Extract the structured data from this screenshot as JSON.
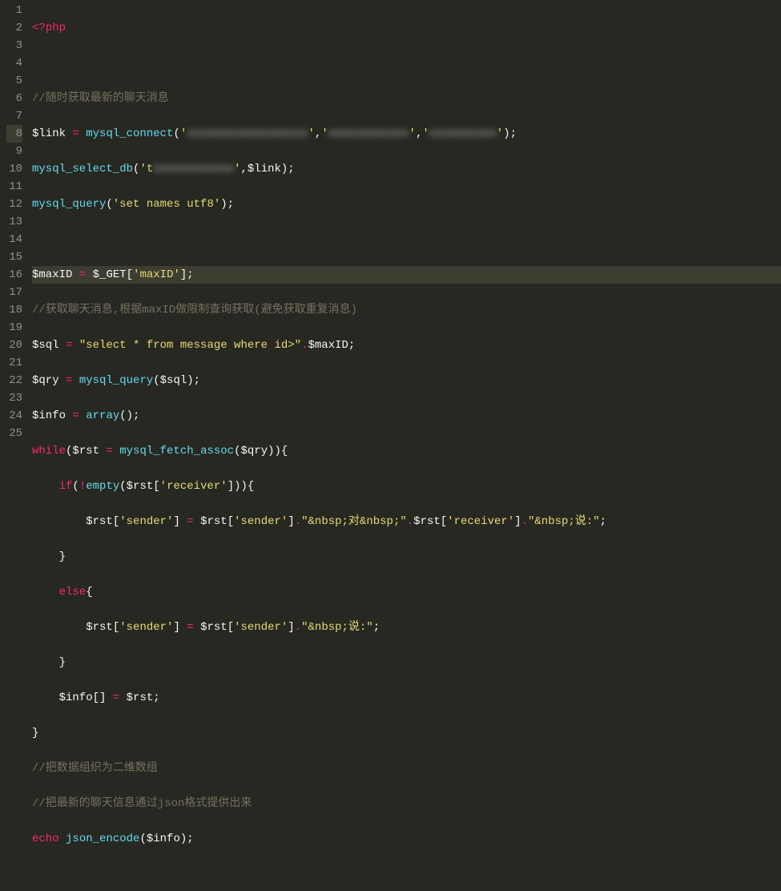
{
  "gutter": [
    "1",
    "2",
    "3",
    "4",
    "5",
    "6",
    "7",
    "8",
    "9",
    "10",
    "11",
    "12",
    "13",
    "14",
    "15",
    "16",
    "17",
    "18",
    "19",
    "20",
    "21",
    "22",
    "23",
    "24",
    "25"
  ],
  "highlighted_line": 8,
  "code": {
    "l1": {
      "php_open": "<?php"
    },
    "l3": {
      "comment": "//随时获取最新的聊天消息"
    },
    "l4": {
      "var": "$link",
      "assign": " = ",
      "fn": "mysql_connect",
      "lp": "(",
      "s1": "'",
      "blur1": "xxxxxxxxxxxxxxxxxx",
      "s1e": "'",
      "c1": ",",
      "s2": "'",
      "blur2": "xxxxxxxxxxxx",
      "s2e": "'",
      "c2": ",",
      "s3": "'",
      "blur3": "xxxxxxxxxx",
      "s3e": "'",
      "rp": ");"
    },
    "l5": {
      "fn": "mysql_select_db",
      "lp": "(",
      "s1": "'",
      "char": "t",
      "blur": "xxxxxxxxxxxx",
      "s1e": "'",
      "c": ",",
      "var": "$link",
      "rp": ");"
    },
    "l6": {
      "fn": "mysql_query",
      "lp": "(",
      "str": "'set names utf8'",
      "rp": ");"
    },
    "l8": {
      "var": "$maxID",
      "assign": " = ",
      "var2": "$_GET",
      "lb": "[",
      "str": "'maxID'",
      "rb": "];"
    },
    "l9": {
      "comment": "//获取聊天消息,根据maxID做限制查询获取(避免获取重复消息)"
    },
    "l10": {
      "var": "$sql",
      "assign": " = ",
      "str": "\"select * from message where id>\"",
      "dot": ".",
      "var2": "$maxID",
      "semi": ";"
    },
    "l11": {
      "var": "$qry",
      "assign": " = ",
      "fn": "mysql_query",
      "lp": "(",
      "arg": "$sql",
      "rp": ");"
    },
    "l12": {
      "var": "$info",
      "assign": " = ",
      "fn": "array",
      "lp": "(",
      "rp": ");"
    },
    "l13": {
      "kw": "while",
      "lp": "(",
      "var": "$rst",
      "assign": " = ",
      "fn": "mysql_fetch_assoc",
      "lp2": "(",
      "arg": "$qry",
      "rp2": ")",
      "rp": "){"
    },
    "l14": {
      "indent": "    ",
      "kw": "if",
      "lp": "(",
      "not": "!",
      "fn": "empty",
      "lp2": "(",
      "var": "$rst",
      "lb": "[",
      "str": "'receiver'",
      "rb": "]",
      "rp2": ")",
      "rp": "){"
    },
    "l15": {
      "indent": "        ",
      "var": "$rst",
      "lb": "[",
      "str": "'sender'",
      "rb": "]",
      "assign": " = ",
      "var2": "$rst",
      "lb2": "[",
      "str2": "'sender'",
      "rb2": "]",
      "dot": ".",
      "str3": "\"&nbsp;对&nbsp;\"",
      "dot2": ".",
      "var3": "$rst",
      "lb3": "[",
      "str4": "'receiver'",
      "rb3": "]",
      "dot3": ".",
      "str5": "\"&nbsp;说:\"",
      "semi": ";"
    },
    "l16": {
      "indent": "    ",
      "brace": "}"
    },
    "l17": {
      "indent": "    ",
      "kw": "else",
      "brace": "{"
    },
    "l18": {
      "indent": "        ",
      "var": "$rst",
      "lb": "[",
      "str": "'sender'",
      "rb": "]",
      "assign": " = ",
      "var2": "$rst",
      "lb2": "[",
      "str2": "'sender'",
      "rb2": "]",
      "dot": ".",
      "str3": "\"&nbsp;说:\"",
      "semi": ";"
    },
    "l19": {
      "indent": "    ",
      "brace": "}"
    },
    "l20": {
      "indent": "    ",
      "var": "$info",
      "lb": "[]",
      "assign": " = ",
      "var2": "$rst",
      "semi": ";"
    },
    "l21": {
      "brace": "}"
    },
    "l22": {
      "comment": "//把数据组织为二维数组"
    },
    "l23": {
      "comment": "//把最新的聊天信息通过json格式提供出来"
    },
    "l24": {
      "kw": "echo",
      "sp": " ",
      "fn": "json_encode",
      "lp": "(",
      "var": "$info",
      "rp": ");"
    }
  }
}
